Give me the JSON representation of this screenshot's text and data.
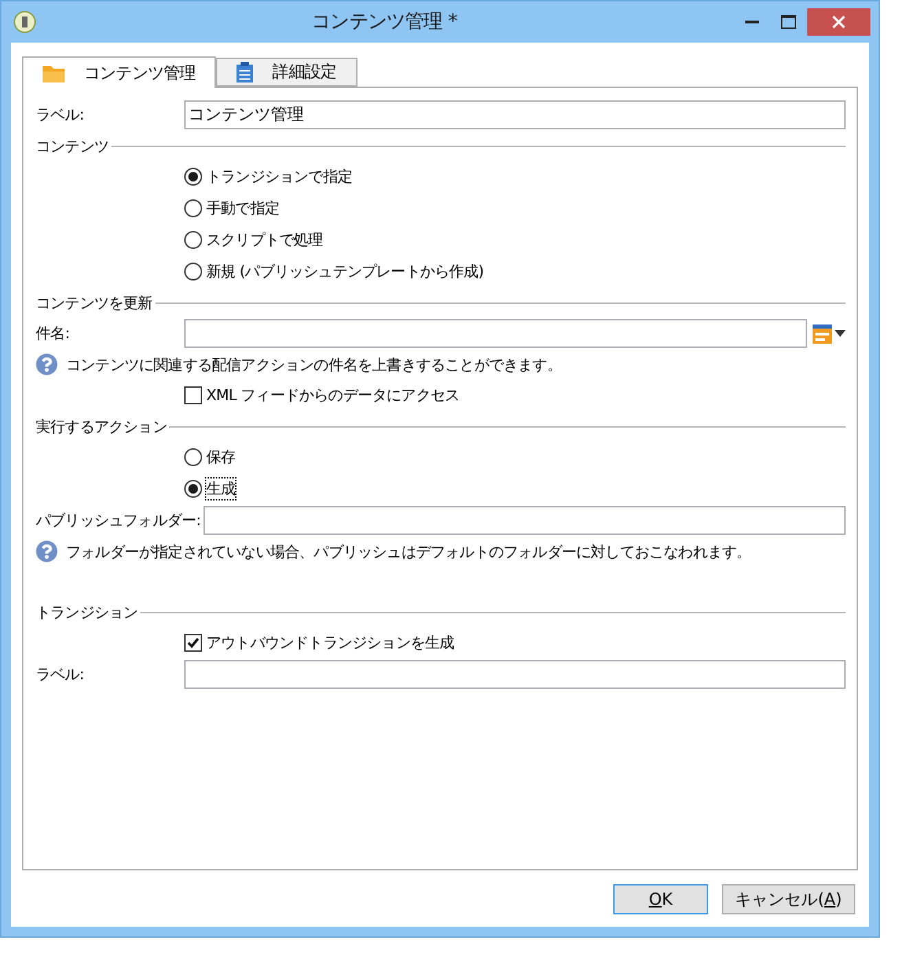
{
  "window": {
    "title": "コンテンツ管理 *"
  },
  "tabs": [
    {
      "label": "コンテンツ管理",
      "selected": true
    },
    {
      "label": "詳細設定",
      "selected": false
    }
  ],
  "top_rows": [
    {
      "kind": "field",
      "label": "ラベル:",
      "value": "コンテンツ管理"
    }
  ],
  "sections": [
    {
      "title": "コンテンツ",
      "rows": [
        {
          "kind": "radio",
          "label": "トランジションで指定",
          "selected": true,
          "focused": false
        },
        {
          "kind": "radio",
          "label": "手動で指定",
          "selected": false,
          "focused": false
        },
        {
          "kind": "radio",
          "label": "スクリプトで処理",
          "selected": false,
          "focused": false
        },
        {
          "kind": "radio",
          "label": "新規 (パブリッシュテンプレートから作成)",
          "selected": false,
          "focused": false
        }
      ]
    },
    {
      "title": "コンテンツを更新",
      "rows": [
        {
          "kind": "field",
          "label": "件名:",
          "picker": true
        },
        {
          "kind": "help",
          "text": "コンテンツに関連する配信アクションの件名を上書きすることができます。"
        },
        {
          "kind": "checkbox",
          "label": "XML フィードからのデータにアクセス",
          "checked": false
        }
      ]
    },
    {
      "title": "実行するアクション",
      "rows": [
        {
          "kind": "radio",
          "label": "保存",
          "selected": false,
          "focused": false
        },
        {
          "kind": "radio",
          "label": "生成",
          "selected": true,
          "focused": true
        },
        {
          "kind": "field",
          "label": "パブリッシュフォルダー:"
        },
        {
          "kind": "help",
          "text": "フォルダーが指定されていない場合、パブリッシュはデフォルトのフォルダーに対しておこなわれます。"
        }
      ]
    },
    {
      "title": "トランジション",
      "rows": [
        {
          "kind": "checkbox",
          "label": "アウトバウンドトランジションを生成",
          "checked": true
        },
        {
          "kind": "field",
          "label": "ラベル:"
        }
      ]
    }
  ],
  "buttons": [
    {
      "key": "O",
      "after": "K",
      "default": true
    },
    {
      "before": "キャンセル(",
      "key": "A",
      "after": ")",
      "default": false
    }
  ]
}
